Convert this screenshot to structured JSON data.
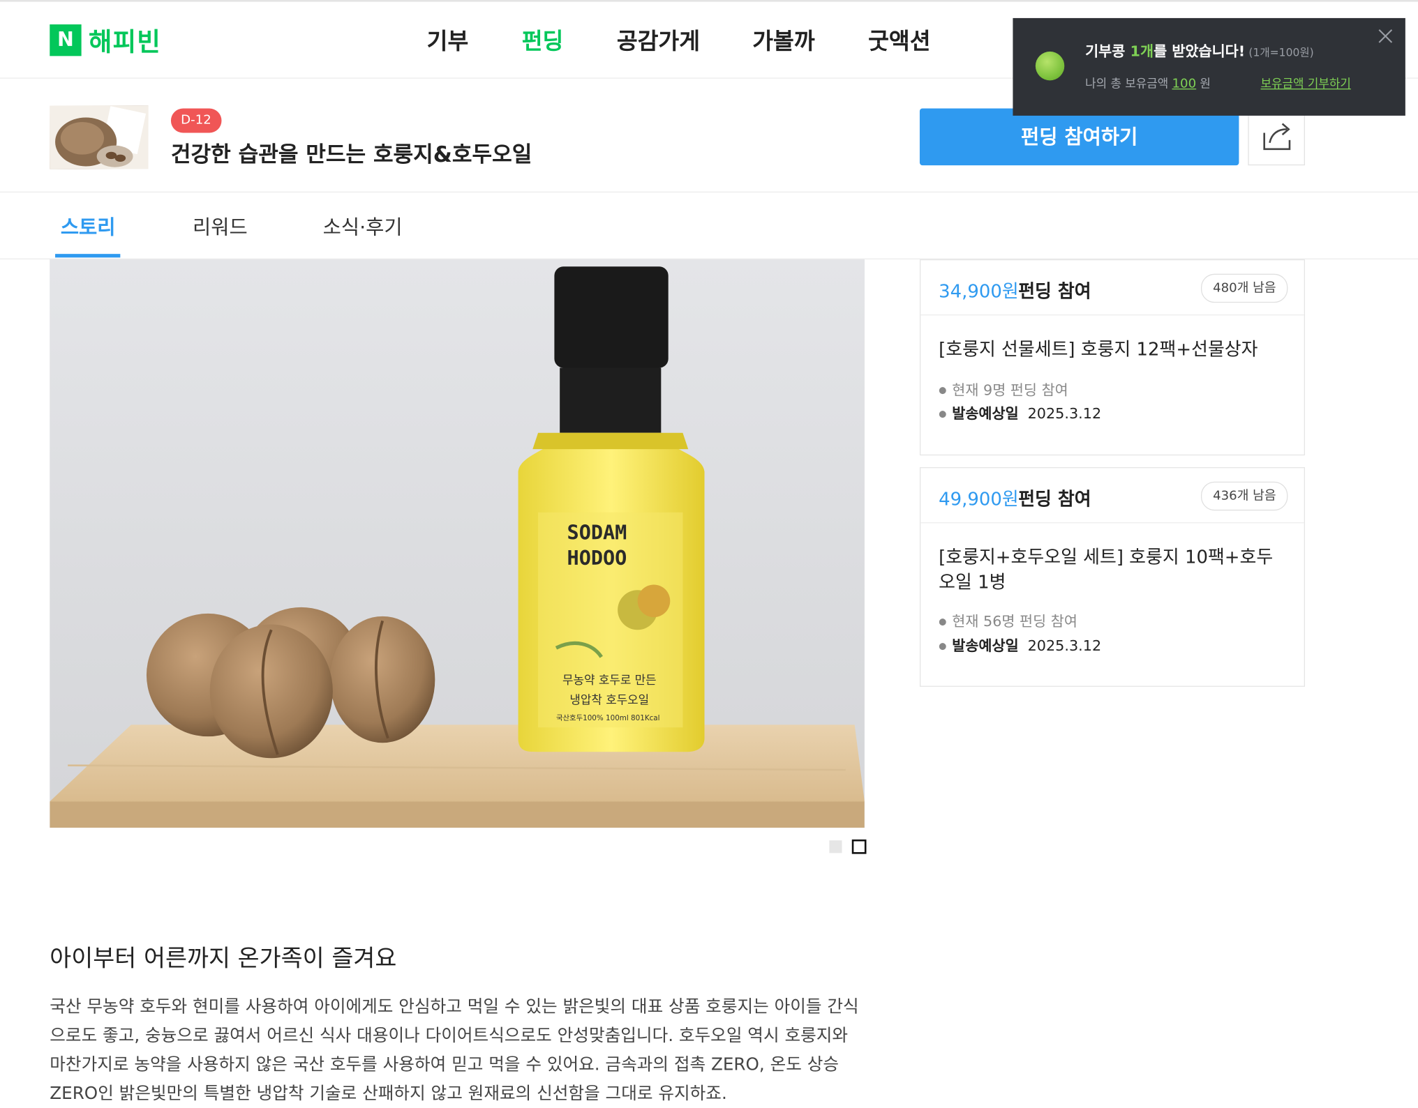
{
  "nav": {
    "logo_mark": "N",
    "logo_text": "해피빈",
    "items": [
      {
        "label": "기부",
        "active": false
      },
      {
        "label": "펀딩",
        "active": true
      },
      {
        "label": "공감가게",
        "active": false
      },
      {
        "label": "가볼까",
        "active": false
      },
      {
        "label": "굿액션",
        "active": false
      }
    ]
  },
  "toast": {
    "title_prefix": "기부콩 ",
    "title_highlight": "1개",
    "title_suffix": "를 받았습니다!",
    "rate_note": "(1개=100원)",
    "balance_label": "나의 총 보유금액",
    "balance_amount": "100",
    "balance_unit": "원",
    "donate_link": "보유금액 기부하기",
    "close_icon": "close-icon",
    "bean_icon": "bean-icon"
  },
  "project": {
    "dday": "D-12",
    "title": "건강한 습관을 만드는 호룽지&호두오일",
    "fund_button": "펀딩 참여하기",
    "share_icon": "share-icon"
  },
  "tabs": [
    {
      "label": "스토리",
      "active": true
    },
    {
      "label": "리워드",
      "active": false
    },
    {
      "label": "소식·후기",
      "active": false
    }
  ],
  "product_image": {
    "label_line1": "SODAM",
    "label_line2": "HODOO",
    "label_line3": "무농약 호두로 만든",
    "label_line4": "냉압착 호두오일",
    "label_line5": "국산호두100% 100ml 801Kcal",
    "carousel_total": 2,
    "carousel_current": 2
  },
  "story": {
    "heading": "아이부터 어른까지 온가족이 즐겨요",
    "body": "국산 무농약 호두와 현미를 사용하여 아이에게도 안심하고 먹일 수 있는 밝은빛의 대표 상품 호룽지는 아이들 간식으로도 좋고, 숭늉으로 끓여서 어르신 식사 대용이나 다이어트식으로도 안성맞춤입니다. 호두오일 역시 호룽지와 마찬가지로 농약을 사용하지 않은 국산 호두를 사용하여 믿고 먹을 수 있어요. 금속과의 접촉 ZERO, 온도 상승 ZERO인 밝은빛만의 특별한 냉압착 기술로 산패하지 않고 원재료의 신선함을 그대로 유지하죠."
  },
  "rewards": [
    {
      "price": "34,900원",
      "price_suffix": "펀딩 참여",
      "remaining": "480개 남음",
      "name": "[호룽지 선물세트] 호룽지 12팩+선물상자",
      "participants": "현재 9명 펀딩 참여",
      "ship_label": "발송예상일",
      "ship_date": "2025.3.12"
    },
    {
      "price": "49,900원",
      "price_suffix": "펀딩 참여",
      "remaining": "436개 남음",
      "name": "[호룽지+호두오일 세트] 호룽지 10팩+호두오일 1병",
      "participants": "현재 56명 펀딩 참여",
      "ship_label": "발송예상일",
      "ship_date": "2025.3.12"
    }
  ],
  "colors": {
    "brand_green": "#03c75a",
    "accent_blue": "#2f9af0",
    "dday_red": "#f05656",
    "toast_bg": "#2f3237"
  }
}
